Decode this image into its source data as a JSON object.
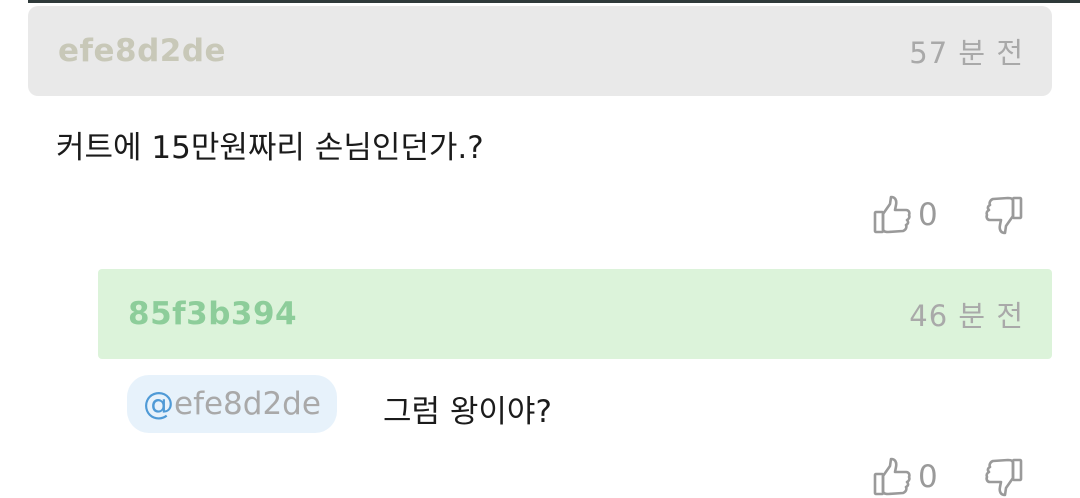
{
  "comments": [
    {
      "author": "efe8d2de",
      "time": "57 분 전",
      "text": "커트에 15만원짜리 손님인던가.?",
      "likes": "0"
    },
    {
      "author": "85f3b394",
      "time": "46 분 전",
      "mention_at": "@",
      "mention_handle": "efe8d2de",
      "text": "그럼 왕이야?",
      "likes": "0"
    }
  ],
  "colors": {
    "header_gray": "#e9e9e9",
    "header_green": "#dcf3da",
    "author_gray": "#c8c8b8",
    "author_green": "#8dcd9a",
    "mention_bg": "#e7f2fb",
    "mention_at": "#4f9ad6"
  },
  "icons": {
    "like": "thumbs-up-icon",
    "dislike": "thumbs-down-icon"
  }
}
